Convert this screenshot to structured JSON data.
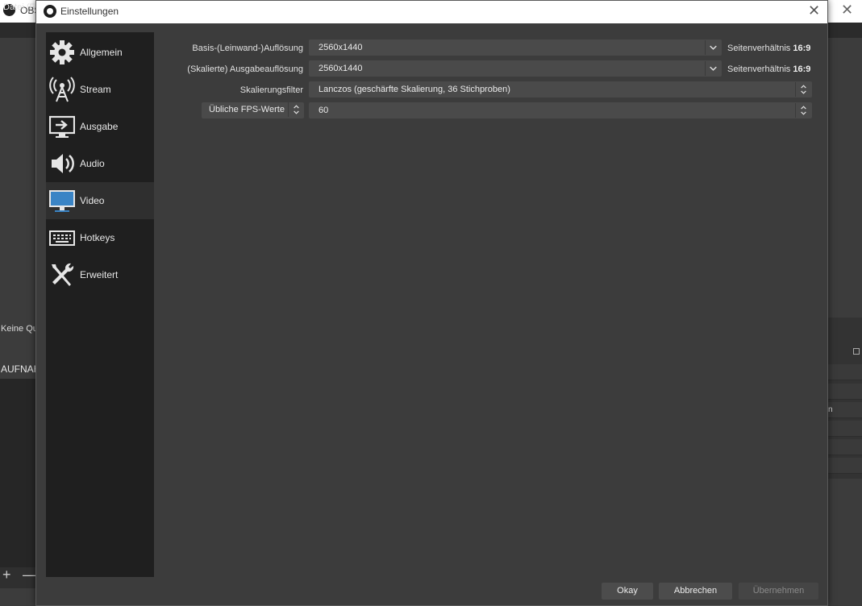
{
  "background_window": {
    "title": "OBS",
    "menu_first": "Datei (F",
    "keine_text": "Keine Qu",
    "aufnahme_text": "AUFNAH",
    "right_fragment": "n"
  },
  "dialog": {
    "title": "Einstellungen"
  },
  "sidebar": {
    "items": [
      {
        "label": "Allgemein",
        "icon": "gear-icon"
      },
      {
        "label": "Stream",
        "icon": "antenna-icon"
      },
      {
        "label": "Ausgabe",
        "icon": "output-monitor-icon"
      },
      {
        "label": "Audio",
        "icon": "speaker-icon"
      },
      {
        "label": "Video",
        "icon": "monitor-icon",
        "selected": true
      },
      {
        "label": "Hotkeys",
        "icon": "keyboard-icon"
      },
      {
        "label": "Erweitert",
        "icon": "tools-icon"
      }
    ]
  },
  "video": {
    "base_resolution_label": "Basis-(Leinwand-)Auflösung",
    "base_resolution_value": "2560x1440",
    "base_aspect_label": "Seitenverhältnis",
    "base_aspect_value": "16:9",
    "output_resolution_label": "(Skalierte) Ausgabeauflösung",
    "output_resolution_value": "2560x1440",
    "output_aspect_label": "Seitenverhältnis",
    "output_aspect_value": "16:9",
    "scale_filter_label": "Skalierungsfilter",
    "scale_filter_value": "Lanczos (geschärfte Skalierung, 36 Stichproben)",
    "fps_type_value": "Übliche FPS-Werte",
    "fps_value": "60"
  },
  "buttons": {
    "ok": "Okay",
    "cancel": "Abbrechen",
    "apply": "Übernehmen"
  }
}
